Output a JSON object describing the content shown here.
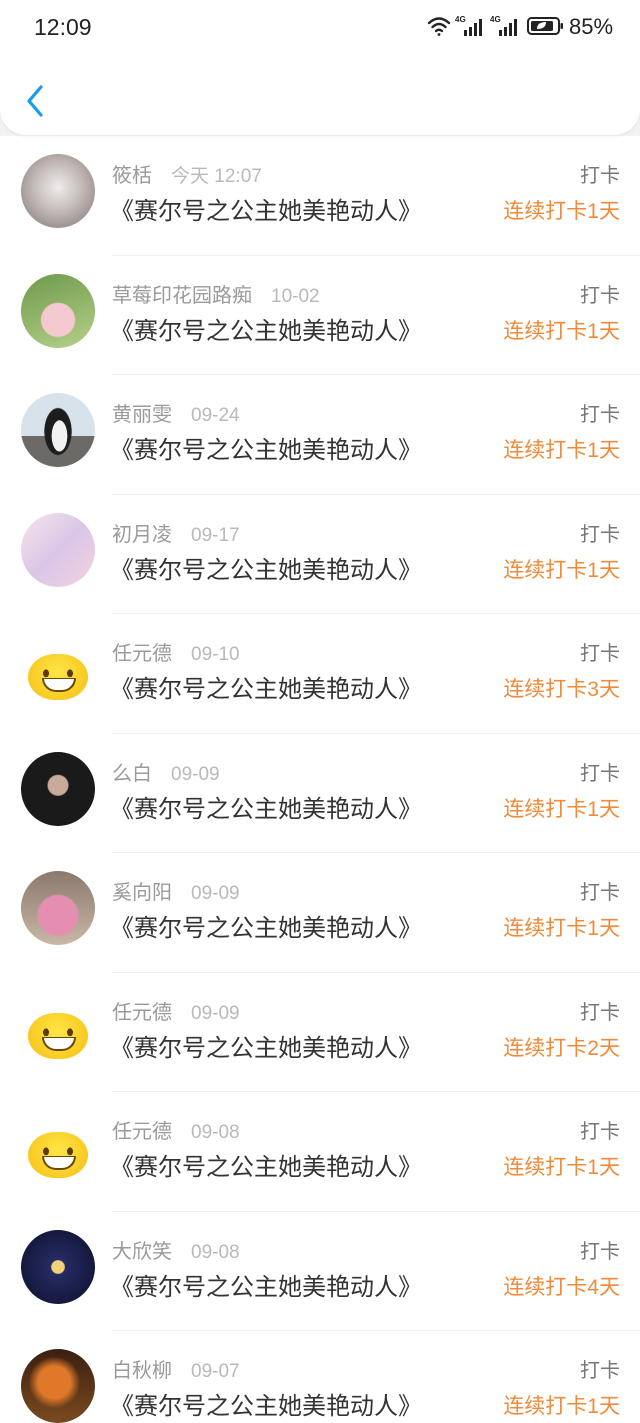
{
  "colors": {
    "accent": "#1a9af0",
    "streak": "#f28a3a"
  },
  "status_bar": {
    "time": "12:09",
    "network": "4G",
    "battery": "85%",
    "icons": [
      "wifi-icon",
      "signal-4g-icon",
      "signal-4g-icon",
      "battery-icon"
    ]
  },
  "header": {
    "back_icon": "chevron-left-icon"
  },
  "list": [
    {
      "name": "筱栝",
      "time": "今天 12:07",
      "book": "《赛尔号之公主她美艳动人》",
      "action": "打卡",
      "streak": "连续打卡1天"
    },
    {
      "name": "草莓印花园路痴",
      "time": "10-02",
      "book": "《赛尔号之公主她美艳动人》",
      "action": "打卡",
      "streak": "连续打卡1天"
    },
    {
      "name": "黄丽雯",
      "time": "09-24",
      "book": "《赛尔号之公主她美艳动人》",
      "action": "打卡",
      "streak": "连续打卡1天"
    },
    {
      "name": "初月凌",
      "time": "09-17",
      "book": "《赛尔号之公主她美艳动人》",
      "action": "打卡",
      "streak": "连续打卡1天"
    },
    {
      "name": "任元德",
      "time": "09-10",
      "book": "《赛尔号之公主她美艳动人》",
      "action": "打卡",
      "streak": "连续打卡3天"
    },
    {
      "name": "么白",
      "time": "09-09",
      "book": "《赛尔号之公主她美艳动人》",
      "action": "打卡",
      "streak": "连续打卡1天"
    },
    {
      "name": "奚向阳",
      "time": "09-09",
      "book": "《赛尔号之公主她美艳动人》",
      "action": "打卡",
      "streak": "连续打卡1天"
    },
    {
      "name": "任元德",
      "time": "09-09",
      "book": "《赛尔号之公主她美艳动人》",
      "action": "打卡",
      "streak": "连续打卡2天"
    },
    {
      "name": "任元德",
      "time": "09-08",
      "book": "《赛尔号之公主她美艳动人》",
      "action": "打卡",
      "streak": "连续打卡1天"
    },
    {
      "name": "大欣笑",
      "time": "09-08",
      "book": "《赛尔号之公主她美艳动人》",
      "action": "打卡",
      "streak": "连续打卡4天"
    },
    {
      "name": "白秋柳",
      "time": "09-07",
      "book": "《赛尔号之公主她美艳动人》",
      "action": "打卡",
      "streak": "连续打卡1天"
    }
  ]
}
